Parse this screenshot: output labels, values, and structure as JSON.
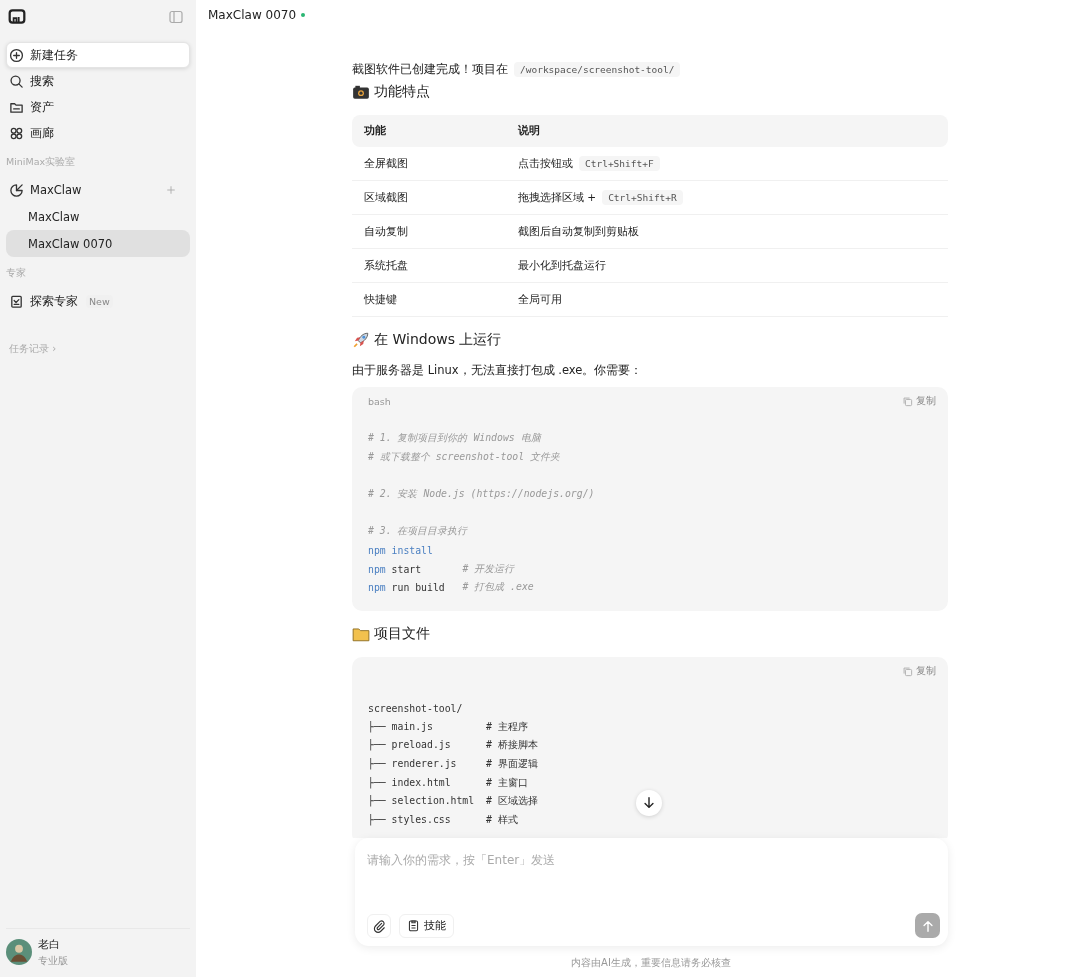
{
  "sidebar": {
    "nav": [
      {
        "label": "新建任务",
        "kind": "new",
        "highlighted": true
      },
      {
        "label": "搜索",
        "kind": "search",
        "highlighted": false
      },
      {
        "label": "资产",
        "kind": "folder",
        "highlighted": false
      },
      {
        "label": "画廊",
        "kind": "gallery",
        "highlighted": false
      }
    ],
    "sections": [
      {
        "title": "MiniMax实验室",
        "items": [
          {
            "label": "MaxClaw",
            "kind": "agent",
            "children": [
              {
                "label": "MaxClaw",
                "selected": false
              },
              {
                "label": "MaxClaw 0070",
                "selected": true
              }
            ]
          }
        ]
      },
      {
        "title": "专家",
        "items": [
          {
            "label": "探索专家",
            "kind": "expert",
            "badge": "New"
          }
        ]
      }
    ],
    "history_link": "任务记录 ›",
    "user": {
      "name": "老白",
      "plan": "专业版"
    }
  },
  "header": {
    "title": "MaxClaw 0070",
    "online": true
  },
  "message": {
    "intro": {
      "text": "截图软件已创建完成！项目在",
      "code": "/workspace/screenshot-tool/"
    },
    "blocks": [
      {
        "kind": "heading",
        "text": "功能特点"
      },
      {
        "kind": "table",
        "columns": [
          "功能",
          "说明"
        ],
        "rows": [
          [
            {
              "text": "全屏截图"
            },
            {
              "text": "点击按钮或",
              "code": "Ctrl+Shift+F"
            }
          ],
          [
            {
              "text": "区域截图"
            },
            {
              "text": "拖拽选择区域 +",
              "code": "Ctrl+Shift+R"
            }
          ],
          [
            {
              "text": "自动复制"
            },
            {
              "text": "截图后自动复制到剪贴板"
            }
          ],
          [
            {
              "text": "系统托盘"
            },
            {
              "text": "最小化到托盘运行"
            }
          ],
          [
            {
              "text": "快捷键"
            },
            {
              "text": "全局可用"
            }
          ]
        ]
      },
      {
        "kind": "heading",
        "text": "在 Windows 上运行"
      },
      {
        "kind": "paragraph",
        "text": "由于服务器是 Linux，无法直接打包成 .exe。你需要："
      },
      {
        "kind": "code",
        "language": "bash",
        "copy_label": "复制",
        "lines": [
          {
            "segments": [
              {
                "kind": "comment",
                "text": "# 1. 复制项目到你的 Windows 电脑"
              }
            ]
          },
          {
            "segments": [
              {
                "kind": "comment",
                "text": "# 或下载整个 screenshot-tool 文件夹"
              }
            ]
          },
          {
            "gap_before": true,
            "segments": [
              {
                "kind": "comment",
                "text": "# 2. 安装 Node.js (https://nodejs.org/)"
              }
            ]
          },
          {
            "gap_before": true,
            "segments": [
              {
                "kind": "comment",
                "text": "# 3. 在项目目录执行"
              }
            ]
          },
          {
            "segments": [
              {
                "kind": "command",
                "text": "npm"
              },
              {
                "kind": "keyword",
                "text": " install"
              }
            ]
          },
          {
            "segments": [
              {
                "kind": "command",
                "text": "npm"
              },
              {
                "kind": "plain",
                "text": " start       "
              },
              {
                "kind": "comment",
                "text": "# 开发运行"
              }
            ]
          },
          {
            "segments": [
              {
                "kind": "command",
                "text": "npm"
              },
              {
                "kind": "plain",
                "text": " run build   "
              },
              {
                "kind": "comment",
                "text": "# 打包成 .exe"
              }
            ]
          }
        ]
      },
      {
        "kind": "heading",
        "text": "项目文件"
      },
      {
        "kind": "code",
        "copy_label": "复制",
        "lines": [
          {
            "segments": [
              {
                "kind": "plain",
                "text": "screenshot-tool/"
              }
            ]
          },
          {
            "segments": [
              {
                "kind": "plain",
                "text": "├── main.js         # 主程序"
              }
            ]
          },
          {
            "segments": [
              {
                "kind": "plain",
                "text": "├── preload.js      # 桥接脚本"
              }
            ]
          },
          {
            "segments": [
              {
                "kind": "plain",
                "text": "├── renderer.js     # 界面逻辑"
              }
            ]
          },
          {
            "segments": [
              {
                "kind": "plain",
                "text": "├── index.html      # 主窗口"
              }
            ]
          },
          {
            "segments": [
              {
                "kind": "plain",
                "text": "├── selection.html  # 区域选择"
              }
            ]
          },
          {
            "segments": [
              {
                "kind": "plain",
                "text": "├── styles.css      # 样式"
              }
            ]
          }
        ]
      }
    ]
  },
  "composer": {
    "placeholder": "请输入你的需求，按「Enter」发送",
    "skills_label": "技能",
    "send_enabled": false
  },
  "footer_note": "内容由AI生成，重要信息请务必核查"
}
